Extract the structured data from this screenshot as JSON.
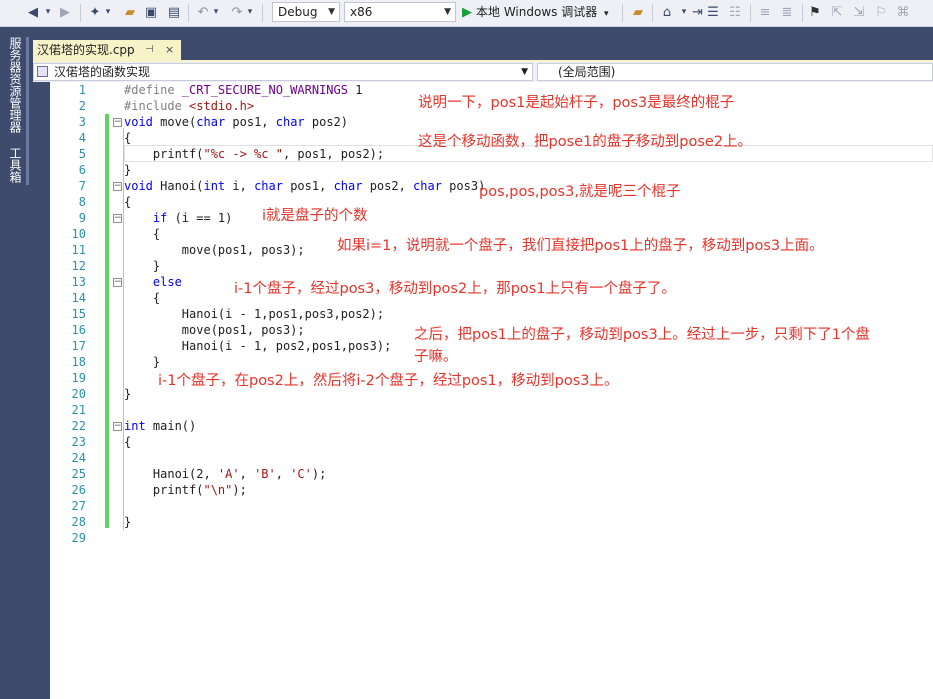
{
  "toolbar": {
    "config": "Debug",
    "platform": "x86",
    "run_label": "本地 Windows 调试器"
  },
  "left_strip": {
    "tabs": [
      "服务器资源管理器",
      "工具箱"
    ]
  },
  "tab": {
    "title": "汉偌塔的实现.cpp",
    "pin": "⊣",
    "close": "×"
  },
  "nav": {
    "scope": "汉偌塔的函数实现",
    "global": "(全局范围)"
  },
  "line_numbers": [
    "1",
    "2",
    "3",
    "4",
    "5",
    "6",
    "7",
    "8",
    "9",
    "10",
    "11",
    "12",
    "13",
    "14",
    "15",
    "16",
    "17",
    "18",
    "19",
    "20",
    "21",
    "22",
    "23",
    "24",
    "25",
    "26",
    "27",
    "28",
    "29"
  ],
  "code": {
    "l1": "#define _CRT_SECURE_NO_WARNINGS 1",
    "l2": "#include <stdio.h>",
    "l3": "void move(char pos1, char pos2)",
    "l4": "{",
    "l5": "    printf(\"%c -> %c \", pos1, pos2);",
    "l6": "}",
    "l7": "void Hanoi(int i, char pos1, char pos2, char pos3)",
    "l8": "{",
    "l9": "    if (i == 1)",
    "l10": "    {",
    "l11": "        move(pos1, pos3);",
    "l12": "    }",
    "l13": "    else",
    "l14": "    {",
    "l15": "        Hanoi(i - 1,pos1,pos3,pos2);",
    "l16": "        move(pos1, pos3);",
    "l17": "        Hanoi(i - 1, pos2,pos1,pos3);",
    "l18": "    }",
    "l19": "",
    "l20": "}",
    "l21": "",
    "l22": "int main()",
    "l23": "{",
    "l24": "",
    "l25": "    Hanoi(2, 'A', 'B', 'C');",
    "l26": "    printf(\"\\n\");",
    "l27": "",
    "l28": "}",
    "l29": ""
  },
  "notes": {
    "n1": "说明一下，pos1是起始杆子，pos3是最终的棍子",
    "n2": "这是个移动函数，把pose1的盘子移动到pose2上。",
    "n3": "pos,pos,pos3,就是呢三个棍子",
    "n4": "i就是盘子的个数",
    "n5": "如果i=1，说明就一个盘子，我们直接把pos1上的盘子，移动到pos3上面。",
    "n6": "i-1个盘子，经过pos3，移动到pos2上，那pos1上只有一个盘子了。",
    "n7a": "之后，把pos1上的盘子，移动到pos3上。经过上一步，只剩下了1个盘",
    "n7b": "子嘛。",
    "n8": "i-1个盘子，在pos2上，然后将i-2个盘子，经过pos1，移动到pos3上。"
  },
  "colors": {
    "keyword": "#0000ff",
    "note": "#e8332a",
    "line_number": "#2b91af",
    "change_bar": "#5fd35f"
  }
}
